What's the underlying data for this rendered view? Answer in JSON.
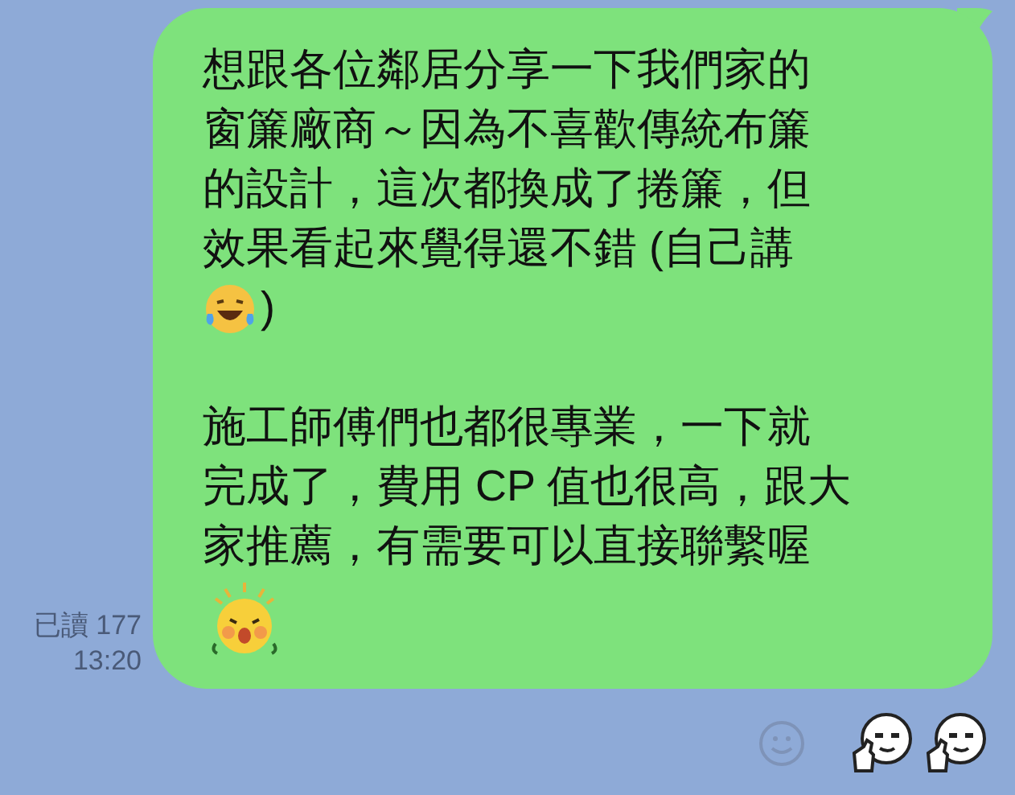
{
  "message": {
    "read_receipt": "已讀 177",
    "time": "13:20",
    "paragraphs": [
      {
        "lines": [
          "想跟各位鄰居分享一下我們家的",
          "窗簾廠商～因為不喜歡傳統布簾",
          "的設計，這次都換成了捲簾，但",
          "效果看起來覺得還不錯 (自己講"
        ],
        "end": {
          "kind": "laughing",
          "after": ")"
        }
      },
      {
        "lines": [
          "施工師傅們也都很專業，一下就",
          "完成了，費用 CP 值也很高，跟大",
          "家推薦，有需要可以直接聯繫喔"
        ],
        "end": {
          "kind": "cheer"
        }
      }
    ]
  },
  "reactions": [
    {
      "kind": "thumbs_up"
    },
    {
      "kind": "thumbs_up"
    }
  ]
}
